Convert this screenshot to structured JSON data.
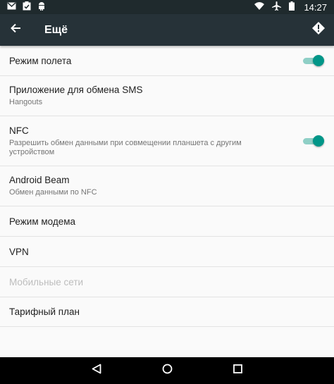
{
  "status_bar": {
    "left_icons": [
      "mail-icon",
      "clipboard-check-icon",
      "android-icon"
    ],
    "right_icons": [
      "wifi-icon",
      "airplane-icon",
      "battery-icon"
    ],
    "time": "14:27"
  },
  "app_bar": {
    "title": "Ещё",
    "back_icon": "arrow-left-icon",
    "action_icon": "alert-icon"
  },
  "settings": [
    {
      "title": "Режим полета",
      "subtitle": null,
      "toggle": true,
      "enabled": true
    },
    {
      "title": "Приложение для обмена SMS",
      "subtitle": "Hangouts",
      "toggle": null,
      "enabled": true
    },
    {
      "title": "NFC",
      "subtitle": "Разрешить обмен данными при совмещении планшета с другим устройством",
      "toggle": true,
      "enabled": true
    },
    {
      "title": "Android Beam",
      "subtitle": "Обмен данными по NFC",
      "toggle": null,
      "enabled": true
    },
    {
      "title": "Режим модема",
      "subtitle": null,
      "toggle": null,
      "enabled": true
    },
    {
      "title": "VPN",
      "subtitle": null,
      "toggle": null,
      "enabled": true
    },
    {
      "title": "Мобильные сети",
      "subtitle": null,
      "toggle": null,
      "enabled": false
    },
    {
      "title": "Тарифный план",
      "subtitle": null,
      "toggle": null,
      "enabled": true
    }
  ],
  "nav_bar": {
    "buttons": [
      "back-triangle-icon",
      "home-circle-icon",
      "recents-square-icon"
    ]
  },
  "colors": {
    "status_bar": "#1f2a2d",
    "app_bar": "#263238",
    "accent": "#009688",
    "background": "#fafafa"
  }
}
